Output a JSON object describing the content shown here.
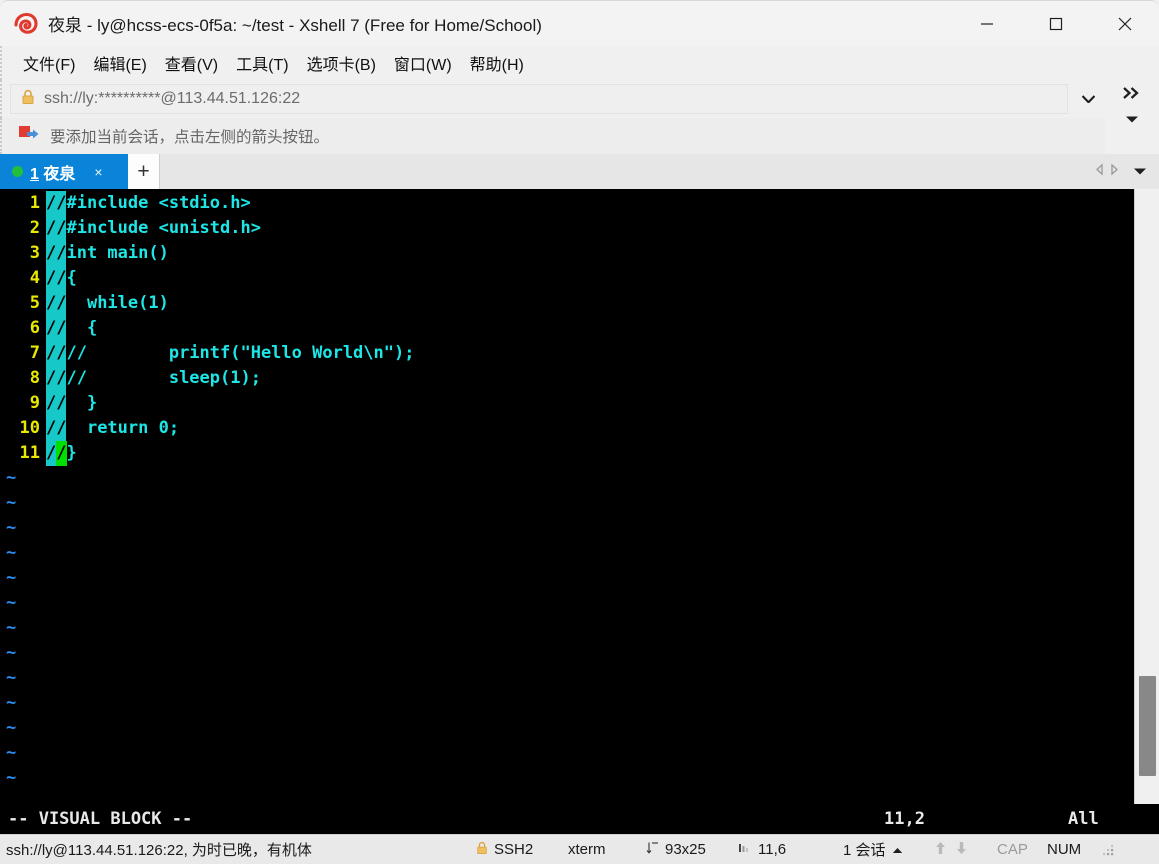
{
  "window": {
    "title": "夜泉 - ly@hcss-ecs-0f5a: ~/test - Xshell 7 (Free for Home/School)",
    "logo_icon": "xshell-spiral-logo",
    "minimize_label": "—",
    "maximize_label": "□",
    "close_label": "✕"
  },
  "menubar": {
    "items": [
      {
        "label": "文件(F)",
        "name": "file"
      },
      {
        "label": "编辑(E)",
        "name": "edit"
      },
      {
        "label": "查看(V)",
        "name": "view"
      },
      {
        "label": "工具(T)",
        "name": "tools"
      },
      {
        "label": "选项卡(B)",
        "name": "tabs"
      },
      {
        "label": "窗口(W)",
        "name": "window"
      },
      {
        "label": "帮助(H)",
        "name": "help"
      }
    ]
  },
  "addressbar": {
    "value": "ssh://ly:**********@113.44.51.126:22",
    "placeholder": "ssh://",
    "lock_icon": "lock-icon",
    "dropdown_icon": "chevron-down-icon",
    "overflow_icon": "double-chevron-right-icon",
    "overflow_caret_icon": "caret-down-icon"
  },
  "notice": {
    "icon": "add-session-flag-icon",
    "text": "要添加当前会话，点击左侧的箭头按钮。"
  },
  "tabbar": {
    "tabs": [
      {
        "index": "1",
        "label": "夜泉",
        "status_icon": "green-status-dot",
        "close_label": "×",
        "active": true
      }
    ],
    "new_tab_label": "+",
    "nav_prev_icon": "triangle-left-icon",
    "nav_next_icon": "triangle-right-icon",
    "nav_menu_icon": "caret-down-icon"
  },
  "terminal": {
    "font_colors": {
      "background": "#000000",
      "code": "#1ee6e6",
      "line_number": "#e8e800",
      "tilde": "#2b8ef0",
      "selection_bg": "#16c8c8",
      "cursor_bg": "#00e000"
    },
    "lines": [
      {
        "num": "1",
        "sel": "//",
        "rest": "#include <stdio.h>"
      },
      {
        "num": "2",
        "sel": "//",
        "rest": "#include <unistd.h>"
      },
      {
        "num": "3",
        "sel": "//",
        "rest": "int main()"
      },
      {
        "num": "4",
        "sel": "//",
        "rest": "{"
      },
      {
        "num": "5",
        "sel": "//",
        "rest": "  while(1)"
      },
      {
        "num": "6",
        "sel": "//",
        "rest": "  {"
      },
      {
        "num": "7",
        "sel": "//",
        "rest": "//        printf(\"Hello World\\n\");"
      },
      {
        "num": "8",
        "sel": "//",
        "rest": "//        sleep(1);"
      },
      {
        "num": "9",
        "sel": "//",
        "rest": "  }"
      },
      {
        "num": "10",
        "sel": "//",
        "rest": "  return 0;"
      },
      {
        "num": "11",
        "sel": "/",
        "cursor": "/",
        "rest": "}"
      }
    ],
    "tilde_count": 13,
    "tilde_char": "~",
    "vim_mode": "-- VISUAL BLOCK --",
    "vim_position": "11,2",
    "vim_percent": "All"
  },
  "statusbar": {
    "connection": "ssh://ly@113.44.51.126:22, 为时已晚，有机体",
    "security_icon": "lock-icon",
    "security": "SSH2",
    "term_type": "xterm",
    "size_icon": "resize-icon",
    "size": "93x25",
    "cursor_icon": "column-icon",
    "cursor": "11,6",
    "sessions": "1 会话",
    "sessions_caret_icon": "caret-up-icon",
    "xfer_up_icon": "arrow-up-icon",
    "xfer_down_icon": "arrow-down-icon",
    "caps": "CAP",
    "num": "NUM",
    "grip_icon": "resize-grip-icon"
  }
}
